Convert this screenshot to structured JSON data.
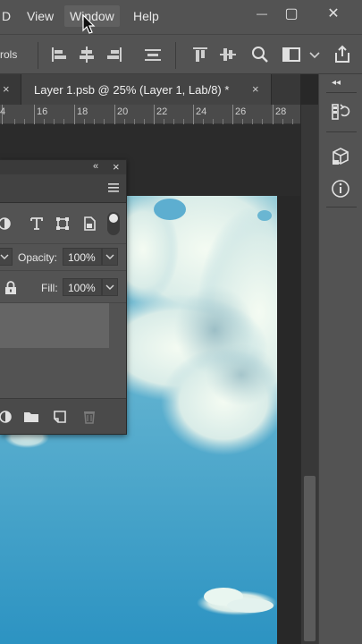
{
  "menubar": {
    "items": [
      "D",
      "View",
      "Window",
      "Help"
    ],
    "controls": {
      "minimize": "—",
      "maximize": "▢",
      "close": "✕"
    }
  },
  "options": {
    "label": "rols",
    "icons": [
      "align-left-edges-icon",
      "align-horizontal-centers-icon",
      "align-right-edges-icon",
      "distribute-icon",
      "align-top-edges-icon",
      "align-vertical-centers-icon",
      "search-icon",
      "workspace-switcher-icon",
      "chevron-down-icon",
      "share-icon"
    ]
  },
  "tabs": {
    "prev_close": "×",
    "active_label": "Layer 1.psb @ 25% (Layer 1, Lab/8) *",
    "active_close": "×"
  },
  "ruler": {
    "labels": [
      "4",
      "16",
      "18",
      "20",
      "22",
      "24",
      "26",
      "28"
    ]
  },
  "dock": {
    "collapse": "◂◂",
    "buttons": [
      "history-icon",
      "3d-cube-icon",
      "info-icon"
    ]
  },
  "layers_panel": {
    "collapse": "«",
    "close": "×",
    "filter_icons": [
      "adjustment-filter-icon",
      "type-filter-icon",
      "shape-filter-icon",
      "smart-object-filter-icon",
      "filter-toggle-icon"
    ],
    "opacity_label": "Opacity:",
    "opacity_value": "100%",
    "fill_label": "Fill:",
    "fill_value": "100%",
    "footer_icons": [
      "adjustment-layer-icon",
      "group-folder-icon",
      "new-layer-icon",
      "trash-icon"
    ]
  },
  "colors": {
    "ui_panel": "#535353",
    "ui_dark": "#282828",
    "sky_top": "#7fc2d8",
    "sky_bottom": "#2b94c3"
  }
}
